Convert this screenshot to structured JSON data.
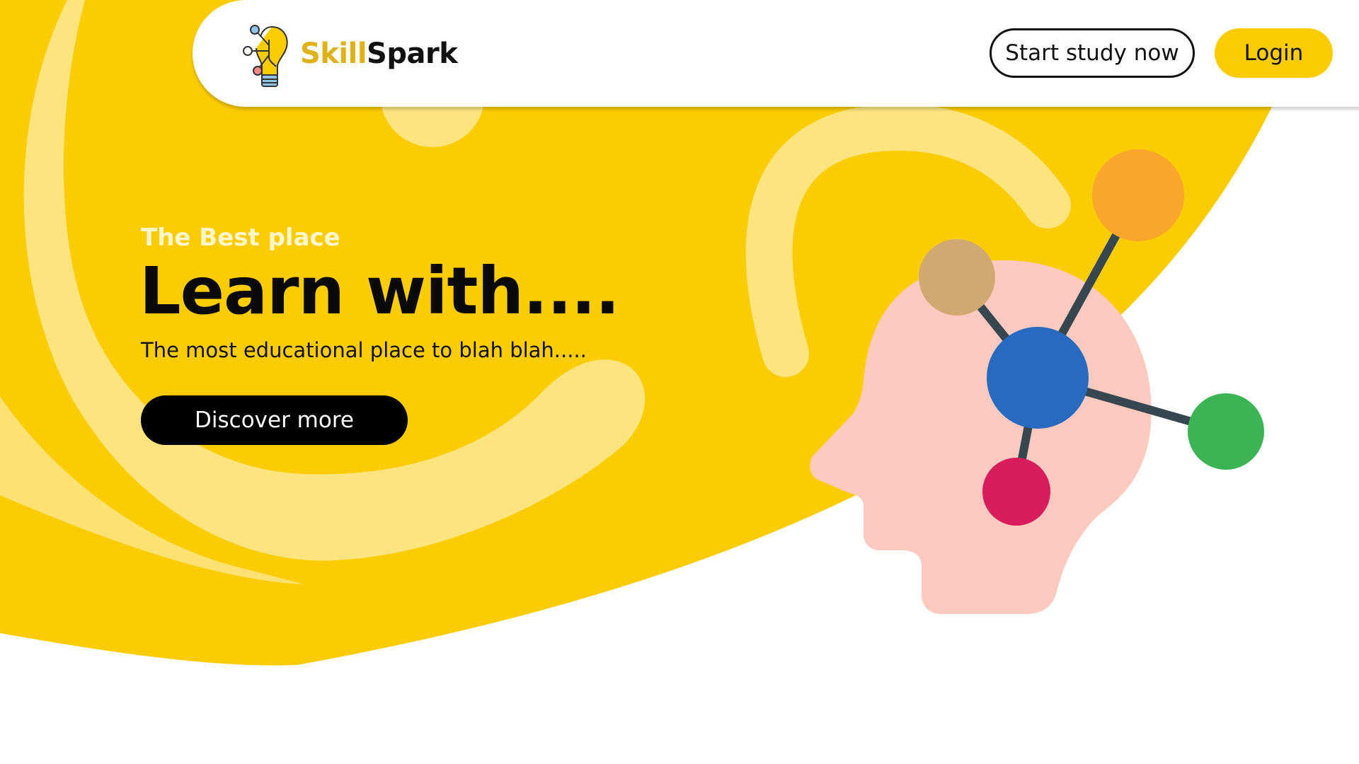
{
  "brand": {
    "name_part1": "Skill",
    "name_part2": "Spark",
    "accent_color": "#fccc02",
    "logo_icon": "lightbulb-network-icon"
  },
  "nav": {
    "start_study_label": "Start study now",
    "login_label": "Login"
  },
  "hero": {
    "kicker": "The Best place",
    "title": "Learn with....",
    "subtitle": "The most educational place to blah blah.....",
    "cta_label": "Discover more",
    "illustration": "head-molecule-icon"
  },
  "colors": {
    "yellow": "#fccc02",
    "light_yellow": "#fde47f",
    "skin": "#fecac0",
    "node_blue": "#266bbf",
    "node_orange": "#f8a72c",
    "node_tan": "#d1a871",
    "node_green": "#3cb454",
    "node_red": "#d91c5c",
    "link_dark": "#37474f"
  }
}
